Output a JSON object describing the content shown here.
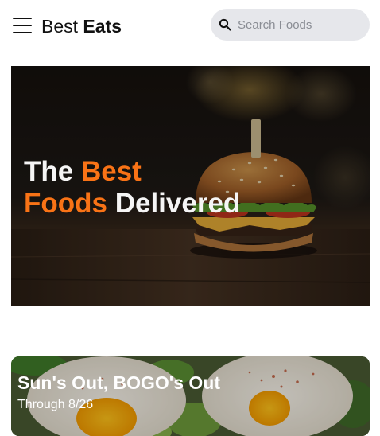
{
  "header": {
    "menu_icon": "hamburger-menu-icon",
    "brand_regular": "Best",
    "brand_bold": "Eats",
    "search": {
      "icon": "search-icon",
      "placeholder": "Search Foods",
      "value": ""
    }
  },
  "hero": {
    "image": "burger-photo",
    "title_part1": "The ",
    "title_part2": "Best",
    "title_part3": "Foods",
    "title_part4": " Delivered",
    "accent_color": "#f97316"
  },
  "promo": {
    "image": "eggs-avocado-photo",
    "title": "Sun's Out, BOGO's Out",
    "subtitle": "Through 8/26"
  }
}
